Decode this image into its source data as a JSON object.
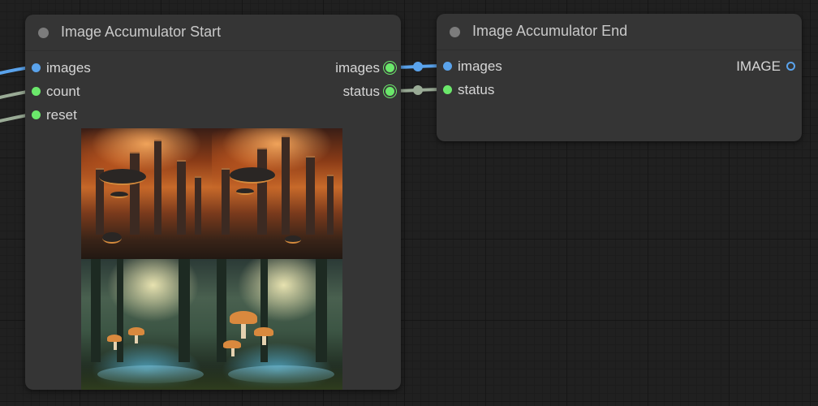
{
  "nodes": {
    "start": {
      "title": "Image Accumulator Start",
      "inputs": [
        {
          "label": "images",
          "type_color": "#5aa3ec"
        },
        {
          "label": "count",
          "type_color": "#6be86b"
        },
        {
          "label": "reset",
          "type_color": "#6be86b"
        }
      ],
      "outputs": [
        {
          "label": "images",
          "type_color": "#6be86b"
        },
        {
          "label": "status",
          "type_color": "#6be86b"
        }
      ],
      "preview_images": [
        "city-airships",
        "city-airships",
        "forest-mushrooms",
        "forest-mushrooms"
      ]
    },
    "end": {
      "title": "Image Accumulator End",
      "inputs": [
        {
          "label": "images",
          "type_color": "#5aa3ec"
        },
        {
          "label": "status",
          "type_color": "#6be86b"
        }
      ],
      "outputs": [
        {
          "label": "IMAGE",
          "type_color": "#5aa3ec"
        }
      ]
    }
  },
  "colors": {
    "canvas": "#202020",
    "node_body": "#353535",
    "wire_image": "#5aa3ec",
    "wire_other": "#9aab96"
  }
}
